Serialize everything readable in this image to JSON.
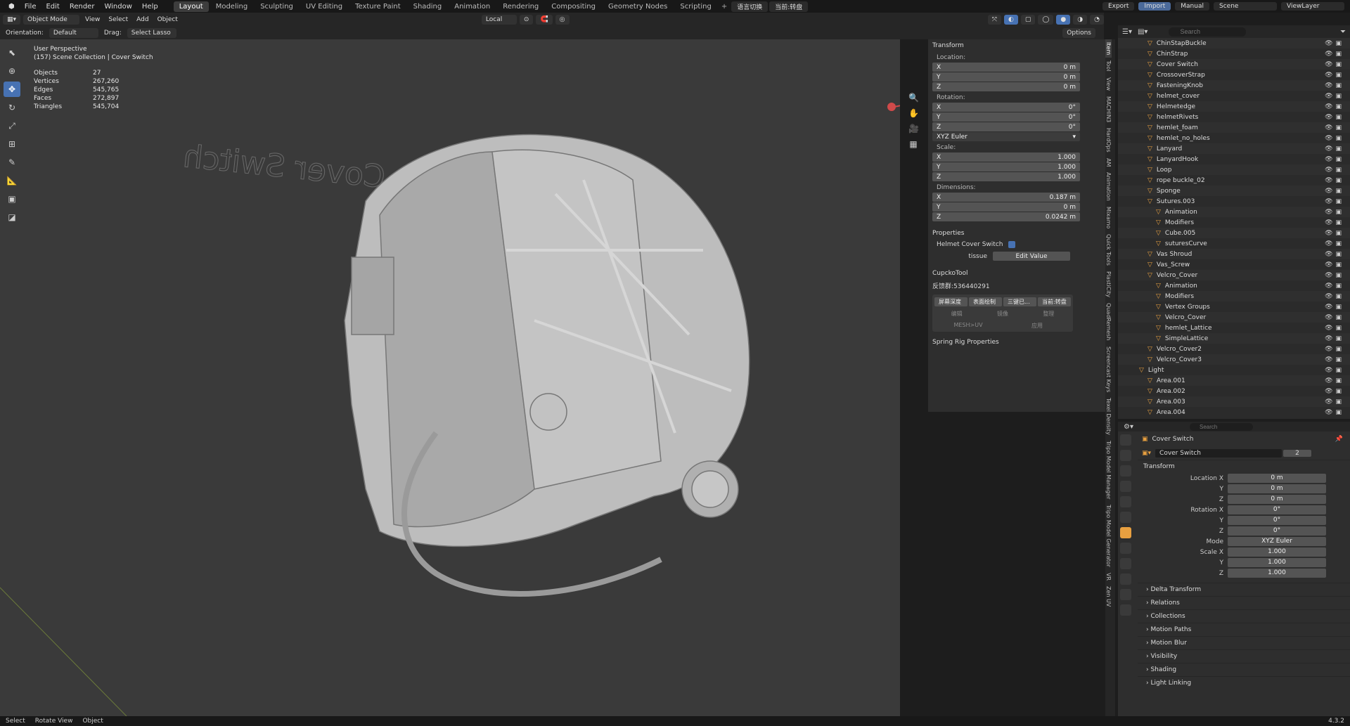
{
  "topbar": {
    "menus": [
      "File",
      "Edit",
      "Render",
      "Window",
      "Help"
    ],
    "workspaces": [
      "Layout",
      "Modeling",
      "Sculpting",
      "UV Editing",
      "Texture Paint",
      "Shading",
      "Animation",
      "Rendering",
      "Compositing",
      "Geometry Nodes",
      "Scripting"
    ],
    "active_workspace": "Layout",
    "extra_buttons": [
      "语言切换",
      "当前:转盘"
    ],
    "export": "Export",
    "import": "Import",
    "manual": "Manual",
    "scene": "Scene",
    "viewlayer": "ViewLayer"
  },
  "header": {
    "mode": "Object Mode",
    "menus": [
      "View",
      "Select",
      "Add",
      "Object"
    ],
    "transform_orientation": "Local",
    "orientation_label": "Orientation:",
    "orientation_value": "Default",
    "drag_label": "Drag:",
    "drag_value": "Select Lasso",
    "options": "Options"
  },
  "viewport": {
    "view_name": "User Perspective",
    "collection_path": "(157) Scene Collection | Cover Switch",
    "stats": [
      {
        "k": "Objects",
        "v": "27"
      },
      {
        "k": "Vertices",
        "v": "267,260"
      },
      {
        "k": "Edges",
        "v": "545,765"
      },
      {
        "k": "Faces",
        "v": "272,897"
      },
      {
        "k": "Triangles",
        "v": "545,704"
      }
    ],
    "mirrored_text": "Cover Switch"
  },
  "npanel": {
    "transform_title": "Transform",
    "location_label": "Location:",
    "location": [
      {
        "a": "X",
        "v": "0 m"
      },
      {
        "a": "Y",
        "v": "0 m"
      },
      {
        "a": "Z",
        "v": "0 m"
      }
    ],
    "rotation_label": "Rotation:",
    "rotation": [
      {
        "a": "X",
        "v": "0°"
      },
      {
        "a": "Y",
        "v": "0°"
      },
      {
        "a": "Z",
        "v": "0°"
      }
    ],
    "rotation_mode": "XYZ Euler",
    "scale_label": "Scale:",
    "scale": [
      {
        "a": "X",
        "v": "1.000"
      },
      {
        "a": "Y",
        "v": "1.000"
      },
      {
        "a": "Z",
        "v": "1.000"
      }
    ],
    "dimensions_label": "Dimensions:",
    "dimensions": [
      {
        "a": "X",
        "v": "0.187 m"
      },
      {
        "a": "Y",
        "v": "0 m"
      },
      {
        "a": "Z",
        "v": "0.0242 m"
      }
    ],
    "properties_title": "Properties",
    "helmet_cover_switch": "Helmet Cover Switch",
    "tissue_label": "tissue",
    "edit_value": "Edit Value",
    "cupcko_title": "CupckoTool",
    "qq_group": "反馈群:536440291",
    "tool_buttons": [
      "屏幕深度",
      "表面绘制",
      "三键已...",
      "当前:转盘"
    ],
    "tool_row2": [
      "编辑",
      "镜像",
      "整理"
    ],
    "tool_row3": [
      "MESH>UV",
      "应用"
    ],
    "spring_title": "Spring Rig Properties"
  },
  "tabs": [
    "Item",
    "Tool",
    "View",
    "MACHIN3",
    "HardOps",
    "AM",
    "Animation",
    "Mixamo",
    "Quick Tools",
    "PlastiCity",
    "QuadRemesh",
    "Screencast Keys",
    "Texel Density",
    "Tripo Model Manager",
    "Tripo Model Generator",
    "VR",
    "Zen UV"
  ],
  "outliner": {
    "search_placeholder": "Search",
    "items": [
      {
        "name": "ChinStapBuckle",
        "indent": 1
      },
      {
        "name": "ChinStrap",
        "indent": 1
      },
      {
        "name": "Cover Switch",
        "indent": 1
      },
      {
        "name": "CrossoverStrap",
        "indent": 1
      },
      {
        "name": "FasteningKnob",
        "indent": 1
      },
      {
        "name": "helmet_cover",
        "indent": 1
      },
      {
        "name": "Helmetedge",
        "indent": 1
      },
      {
        "name": "helmetRivets",
        "indent": 1
      },
      {
        "name": "hemlet_foam",
        "indent": 1
      },
      {
        "name": "hemlet_no_holes",
        "indent": 1
      },
      {
        "name": "Lanyard",
        "indent": 1
      },
      {
        "name": "LanyardHook",
        "indent": 1
      },
      {
        "name": "Loop",
        "indent": 1
      },
      {
        "name": "rope buckle_02",
        "indent": 1
      },
      {
        "name": "Sponge",
        "indent": 1
      },
      {
        "name": "Sutures.003",
        "indent": 1
      },
      {
        "name": "Animation",
        "indent": 2
      },
      {
        "name": "Modifiers",
        "indent": 2
      },
      {
        "name": "Cube.005",
        "indent": 2
      },
      {
        "name": "suturesCurve",
        "indent": 2
      },
      {
        "name": "Vas Shroud",
        "indent": 1
      },
      {
        "name": "Vas_Screw",
        "indent": 1
      },
      {
        "name": "Velcro_Cover",
        "indent": 1
      },
      {
        "name": "Animation",
        "indent": 2
      },
      {
        "name": "Modifiers",
        "indent": 2
      },
      {
        "name": "Vertex Groups",
        "indent": 2
      },
      {
        "name": "Velcro_Cover",
        "indent": 2
      },
      {
        "name": "hemlet_Lattice",
        "indent": 2
      },
      {
        "name": "SimpleLattice",
        "indent": 2
      },
      {
        "name": "Velcro_Cover2",
        "indent": 1
      },
      {
        "name": "Velcro_Cover3",
        "indent": 1
      },
      {
        "name": "Light",
        "indent": 0
      },
      {
        "name": "Area.001",
        "indent": 1
      },
      {
        "name": "Area.002",
        "indent": 1
      },
      {
        "name": "Area.003",
        "indent": 1
      },
      {
        "name": "Area.004",
        "indent": 1
      }
    ]
  },
  "props": {
    "search_placeholder": "Search",
    "object_name": "Cover Switch",
    "datablock": "Cover Switch",
    "users": "2",
    "transform_title": "Transform",
    "rows": [
      {
        "l": "Location X",
        "v": "0 m"
      },
      {
        "l": "Y",
        "v": "0 m"
      },
      {
        "l": "Z",
        "v": "0 m"
      },
      {
        "l": "Rotation X",
        "v": "0°"
      },
      {
        "l": "Y",
        "v": "0°"
      },
      {
        "l": "Z",
        "v": "0°"
      },
      {
        "l": "Mode",
        "v": "XYZ Euler"
      },
      {
        "l": "Scale X",
        "v": "1.000"
      },
      {
        "l": "Y",
        "v": "1.000"
      },
      {
        "l": "Z",
        "v": "1.000"
      }
    ],
    "sections": [
      "Delta Transform",
      "Relations",
      "Collections",
      "Motion Paths",
      "Motion Blur",
      "Visibility",
      "Shading",
      "Light Linking"
    ]
  },
  "statusbar": {
    "items": [
      "Select",
      "Rotate View",
      "Object"
    ],
    "version": "4.3.2"
  },
  "colors": {
    "accent": "#4772b3",
    "viewport_bg": "#3a3a3a",
    "panel_bg": "#2e2e2e",
    "icon_orange": "#e8a040"
  }
}
